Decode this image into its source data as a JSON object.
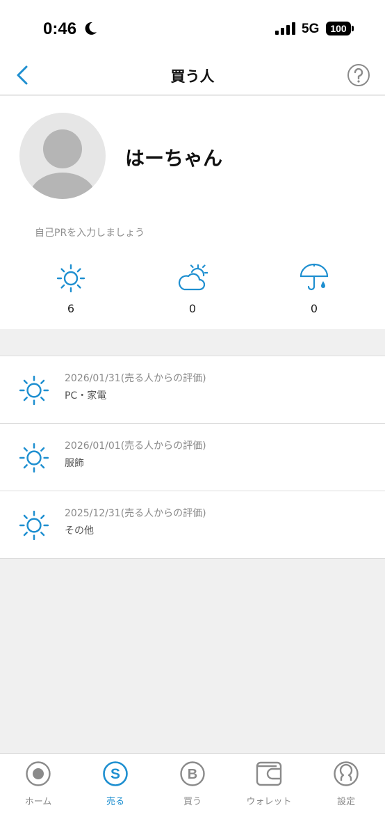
{
  "status_bar": {
    "time": "0:46",
    "network": "5G",
    "battery": "100"
  },
  "header": {
    "title": "買う人"
  },
  "profile": {
    "name": "はーちゃん",
    "pr_placeholder": "自己PRを入力しましょう",
    "ratings": [
      {
        "icon": "sun-icon",
        "count": "6"
      },
      {
        "icon": "cloud-sun-icon",
        "count": "0"
      },
      {
        "icon": "umbrella-icon",
        "count": "0"
      }
    ]
  },
  "reviews": [
    {
      "icon": "sun-icon",
      "date": "2026/01/31(売る人からの評価)",
      "category": "PC・家電"
    },
    {
      "icon": "sun-icon",
      "date": "2026/01/01(売る人からの評価)",
      "category": "服飾"
    },
    {
      "icon": "sun-icon",
      "date": "2025/12/31(売る人からの評価)",
      "category": "その他"
    }
  ],
  "tab_bar": {
    "items": [
      {
        "label": "ホーム",
        "icon": "home-icon",
        "active": false
      },
      {
        "label": "売る",
        "icon": "sell-icon",
        "active": true
      },
      {
        "label": "買う",
        "icon": "buy-icon",
        "active": false
      },
      {
        "label": "ウォレット",
        "icon": "wallet-icon",
        "active": false
      },
      {
        "label": "設定",
        "icon": "settings-icon",
        "active": false
      }
    ]
  },
  "colors": {
    "accent": "#1e8fd0",
    "inactive": "#8a8a8a",
    "background": "#f0f0f0"
  }
}
